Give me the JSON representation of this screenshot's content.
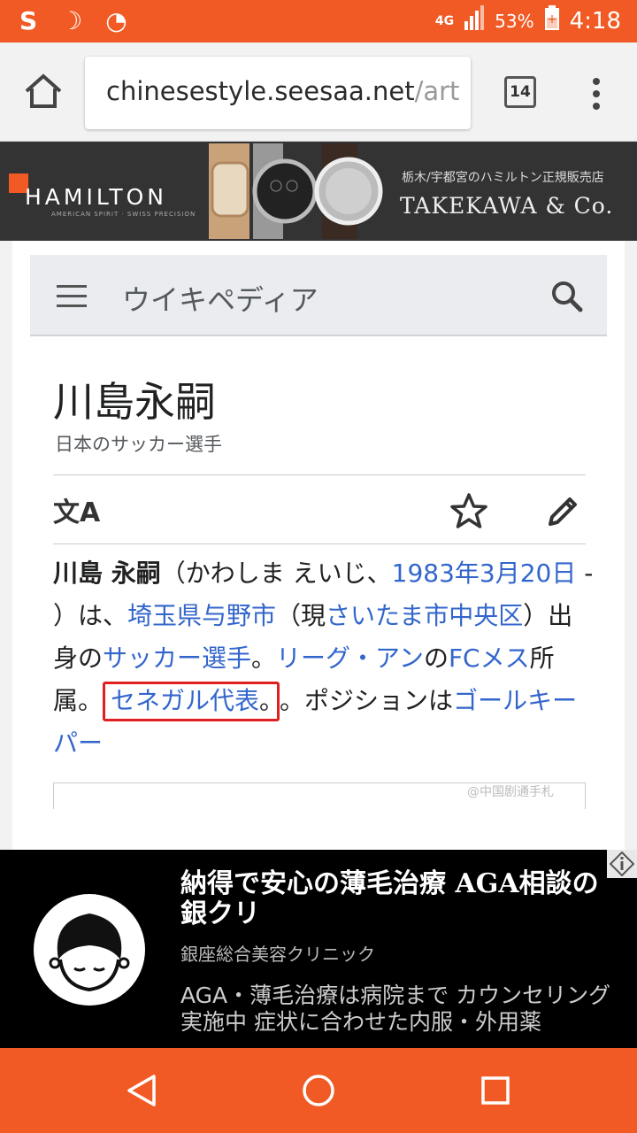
{
  "status_bar": {
    "network": "4G",
    "battery": "53%",
    "time": "4:18"
  },
  "browser": {
    "url_host": "chinesestyle.seesaa.net",
    "url_path": "/art",
    "tab_count": "14"
  },
  "banner_ad": {
    "brand": "HAMILTON",
    "brand_sub": "AMERICAN SPIRIT · SWISS PRECISION",
    "shop_jp": "栃木/宇都宮のハミルトン正規販売店",
    "shop_en": "TAKEKAWA & Co."
  },
  "wiki": {
    "site_title": "ウイキペディア",
    "page_title": "川島永嗣",
    "subtitle": "日本のサッカー選手",
    "paragraph": {
      "t0": "川島 永嗣",
      "t1": "（かわしま えいじ、",
      "l1": "1983年3月20日",
      "t2": " - ）は、",
      "l2": "埼玉県与野市",
      "t3": "（現",
      "l3": "さいたま市中央区",
      "t4": "）出身の",
      "l4": "サッカー選手",
      "t5": "。",
      "l5": "リーグ・アン",
      "t6": "の",
      "l6": "FCメス",
      "t7": "所属。",
      "l7": "セネガル代表",
      "t8": "。ポジションは",
      "l8": "ゴールキーパー"
    },
    "watermark": "@中国剧通手札"
  },
  "bottom_ad": {
    "title": "納得で安心の薄毛治療 AGA相談の銀クリ",
    "sponsor": "銀座総合美容クリニック",
    "description": "AGA・薄毛治療は病院まで カウンセリング実施中 症状に合わせた内服・外用薬"
  },
  "colors": {
    "accent": "#f15a24",
    "link": "#3366cc",
    "highlight_box": "#e02020"
  }
}
